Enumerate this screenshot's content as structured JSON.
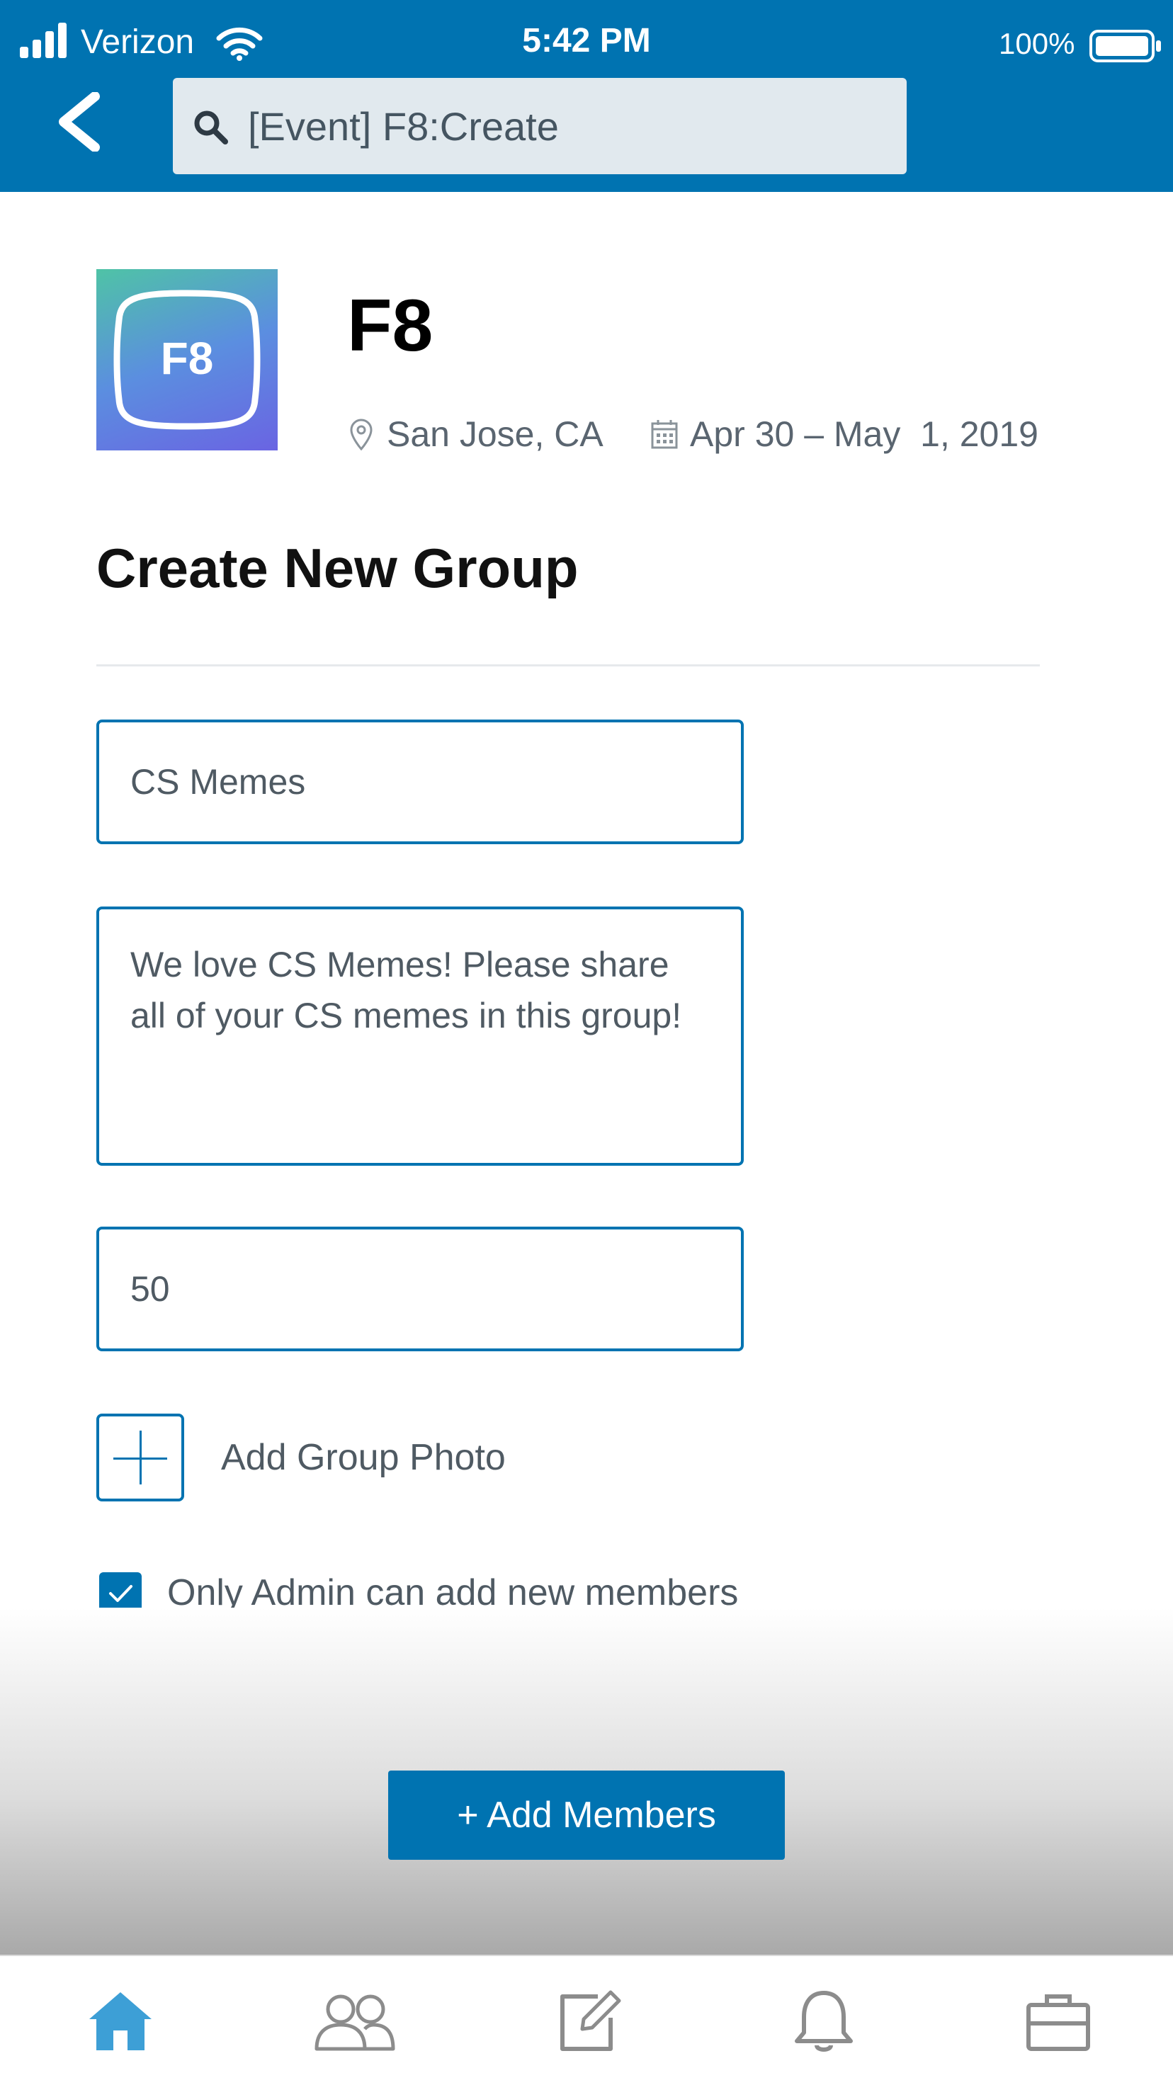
{
  "status_bar": {
    "carrier": "Verizon",
    "time": "5:42 PM",
    "battery_percent": "100%",
    "icons": [
      "signal-icon",
      "wifi-icon",
      "battery-icon"
    ]
  },
  "header": {
    "back_icon": "back-chevron-icon",
    "search_icon": "search-icon",
    "search_value": "[Event] F8:Create"
  },
  "event": {
    "logo_text": "F8",
    "title": "F8",
    "location": "San Jose, CA",
    "dates": "Apr 30 – May  1, 2019",
    "location_icon": "location-pin-icon",
    "date_icon": "calendar-icon"
  },
  "form": {
    "heading": "Create New Group",
    "group_name": "CS Memes",
    "description": "We love CS Memes! Please share all of your CS memes in this group!",
    "member_limit": "50",
    "add_photo_label": "Add Group Photo",
    "admin_only_label": "Only Admin can add new members",
    "admin_only_checked": true,
    "add_members_label": "+ Add Members"
  },
  "tabbar": {
    "tabs": [
      {
        "name": "home",
        "icon": "home-icon",
        "active": true
      },
      {
        "name": "network",
        "icon": "people-icon",
        "active": false
      },
      {
        "name": "post",
        "icon": "compose-icon",
        "active": false
      },
      {
        "name": "notifications",
        "icon": "bell-icon",
        "active": false
      },
      {
        "name": "jobs",
        "icon": "briefcase-icon",
        "active": false
      }
    ]
  },
  "colors": {
    "brand": "#0073b1",
    "search_bg": "#e1e9ee",
    "active_tab": "#3d9fd6",
    "inactive_tab": "#8c8c8c"
  }
}
